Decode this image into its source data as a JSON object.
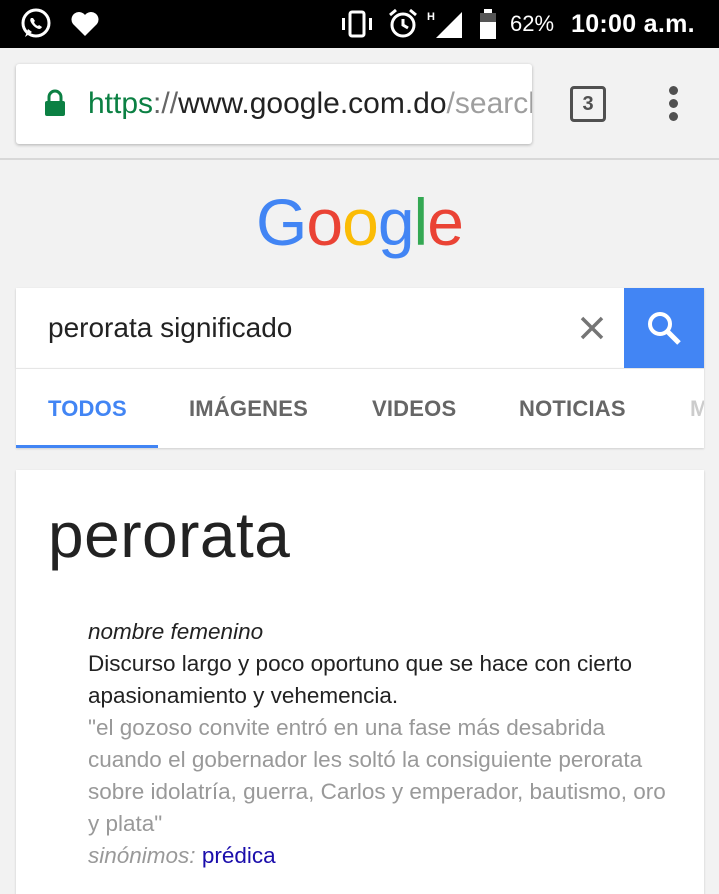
{
  "status_bar": {
    "battery": "62%",
    "time": "10:00 a.m.",
    "network": "H",
    "icons": [
      "whatsapp-icon",
      "heart-icon",
      "vibrate-icon",
      "alarm-icon",
      "signal-icon",
      "battery-icon"
    ]
  },
  "browser": {
    "url_scheme": "https",
    "url_sep": "://",
    "url_host": "www.google.com.do",
    "url_rest": "/search",
    "tab_count": "3",
    "secure_color": "#0b8043"
  },
  "logo": {
    "letters": [
      "G",
      "o",
      "o",
      "g",
      "l",
      "e"
    ],
    "colors": [
      "#4285f4",
      "#ea4335",
      "#fbbc05",
      "#4285f4",
      "#34a853",
      "#ea4335"
    ]
  },
  "search": {
    "query": "perorata significado",
    "button_color": "#4285f4"
  },
  "tabs": [
    {
      "label": "TODOS",
      "active": true
    },
    {
      "label": "IMÁGENES",
      "active": false
    },
    {
      "label": "VIDEOS",
      "active": false
    },
    {
      "label": "NOTICIAS",
      "active": false
    },
    {
      "label": "M",
      "active": false
    }
  ],
  "result": {
    "word": "perorata",
    "part_of_speech": "nombre femenino",
    "definition": "Discurso largo y poco oportuno que se hace con cierto apasionamiento y vehemencia.",
    "example": "\"el gozoso convite entró en una fase más desabrida cuando el gobernador les soltó la consiguiente perorata sobre idolatría, guerra, Carlos y emperador, bautismo, oro y plata\"",
    "synonyms_label": "sinónimos:",
    "synonym": "prédica"
  }
}
